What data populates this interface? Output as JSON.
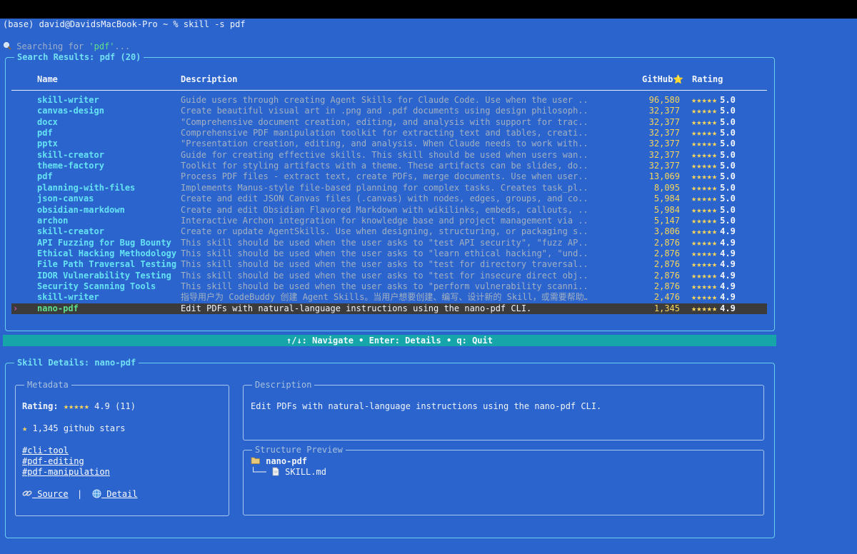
{
  "terminal": {
    "command_line": "(base) david@DavidsMacBook-Pro ~ % skill -s pdf",
    "searching_prefix": "Searching for ",
    "searching_query": "'pdf'",
    "searching_suffix": "..."
  },
  "results_panel": {
    "title": "Search Results: pdf (20)",
    "columns": {
      "name": "Name",
      "description": "Description",
      "github": "GitHub⭐",
      "rating": "Rating"
    },
    "rows": [
      {
        "name": "skill-writer",
        "description": "Guide users through creating Agent Skills for Claude Code. Use when the user ...",
        "stars": "96,580",
        "rating": "5.0"
      },
      {
        "name": "canvas-design",
        "description": "Create beautiful visual art in .png and .pdf documents using design philosoph...",
        "stars": "32,377",
        "rating": "5.0"
      },
      {
        "name": "docx",
        "description": "\"Comprehensive document creation, editing, and analysis with support for trac...",
        "stars": "32,377",
        "rating": "5.0"
      },
      {
        "name": "pdf",
        "description": "Comprehensive PDF manipulation toolkit for extracting text and tables, creati...",
        "stars": "32,377",
        "rating": "5.0"
      },
      {
        "name": "pptx",
        "description": "\"Presentation creation, editing, and analysis. When Claude needs to work with...",
        "stars": "32,377",
        "rating": "5.0"
      },
      {
        "name": "skill-creator",
        "description": "Guide for creating effective skills. This skill should be used when users wan...",
        "stars": "32,377",
        "rating": "5.0"
      },
      {
        "name": "theme-factory",
        "description": "Toolkit for styling artifacts with a theme. These artifacts can be slides, do...",
        "stars": "32,377",
        "rating": "5.0"
      },
      {
        "name": "pdf",
        "description": "Process PDF files - extract text, create PDFs, merge documents. Use when user...",
        "stars": "13,069",
        "rating": "5.0"
      },
      {
        "name": "planning-with-files",
        "description": "Implements Manus-style file-based planning for complex tasks. Creates task_pl...",
        "stars": "8,095",
        "rating": "5.0"
      },
      {
        "name": "json-canvas",
        "description": "Create and edit JSON Canvas files (.canvas) with nodes, edges, groups, and co...",
        "stars": "5,984",
        "rating": "5.0"
      },
      {
        "name": "obsidian-markdown",
        "description": "Create and edit Obsidian Flavored Markdown with wikilinks, embeds, callouts, ...",
        "stars": "5,984",
        "rating": "5.0"
      },
      {
        "name": "archon",
        "description": "Interactive Archon integration for knowledge base and project management via ...",
        "stars": "5,147",
        "rating": "5.0"
      },
      {
        "name": "skill-creator",
        "description": "Create or update AgentSkills. Use when designing, structuring, or packaging s...",
        "stars": "3,806",
        "rating": "4.9"
      },
      {
        "name": "API Fuzzing for Bug Bounty",
        "description": "This skill should be used when the user asks to \"test API security\", \"fuzz AP...",
        "stars": "2,876",
        "rating": "4.9"
      },
      {
        "name": "Ethical Hacking Methodology",
        "description": "This skill should be used when the user asks to \"learn ethical hacking\", \"und...",
        "stars": "2,876",
        "rating": "4.9"
      },
      {
        "name": "File Path Traversal Testing",
        "description": "This skill should be used when the user asks to \"test for directory traversal...",
        "stars": "2,876",
        "rating": "4.9"
      },
      {
        "name": "IDOR Vulnerability Testing",
        "description": "This skill should be used when the user asks to \"test for insecure direct obj...",
        "stars": "2,876",
        "rating": "4.9"
      },
      {
        "name": "Security Scanning Tools",
        "description": "This skill should be used when the user asks to \"perform vulnerability scanni...",
        "stars": "2,876",
        "rating": "4.9"
      },
      {
        "name": "skill-writer",
        "description": "指导用户为 CodeBuddy 创建 Agent Skills。当用户想要创建、编写、设计新的 Skill，或需要帮助…",
        "stars": "2,476",
        "rating": "4.9"
      },
      {
        "name": "nano-pdf",
        "description": "Edit PDFs with natural-language instructions using the nano-pdf CLI.",
        "stars": "1,345",
        "rating": "4.9"
      }
    ],
    "selected_index": 19,
    "stars_glyph": "★★★★★",
    "pointer_glyph": "›"
  },
  "nav_bar": {
    "text": "↑/↓: Navigate • Enter: Details • q: Quit"
  },
  "details_panel": {
    "title": "Skill Details: nano-pdf",
    "metadata": {
      "title": "Metadata",
      "rating_label": "Rating:",
      "rating_stars": "★★★★★",
      "rating_value": "4.9 (11)",
      "github_stars": "1,345 github stars",
      "tags": [
        "#cli-tool",
        "#pdf-editing",
        "#pdf-manipulation"
      ],
      "source_label": "Source",
      "separator": "|",
      "detail_label": "Detail"
    },
    "description": {
      "title": "Description",
      "text": "Edit PDFs with natural-language instructions using the nano-pdf CLI."
    },
    "structure": {
      "title": "Structure Preview",
      "folder": "nano-pdf",
      "branch": "└──",
      "file": "SKILL.md"
    }
  }
}
